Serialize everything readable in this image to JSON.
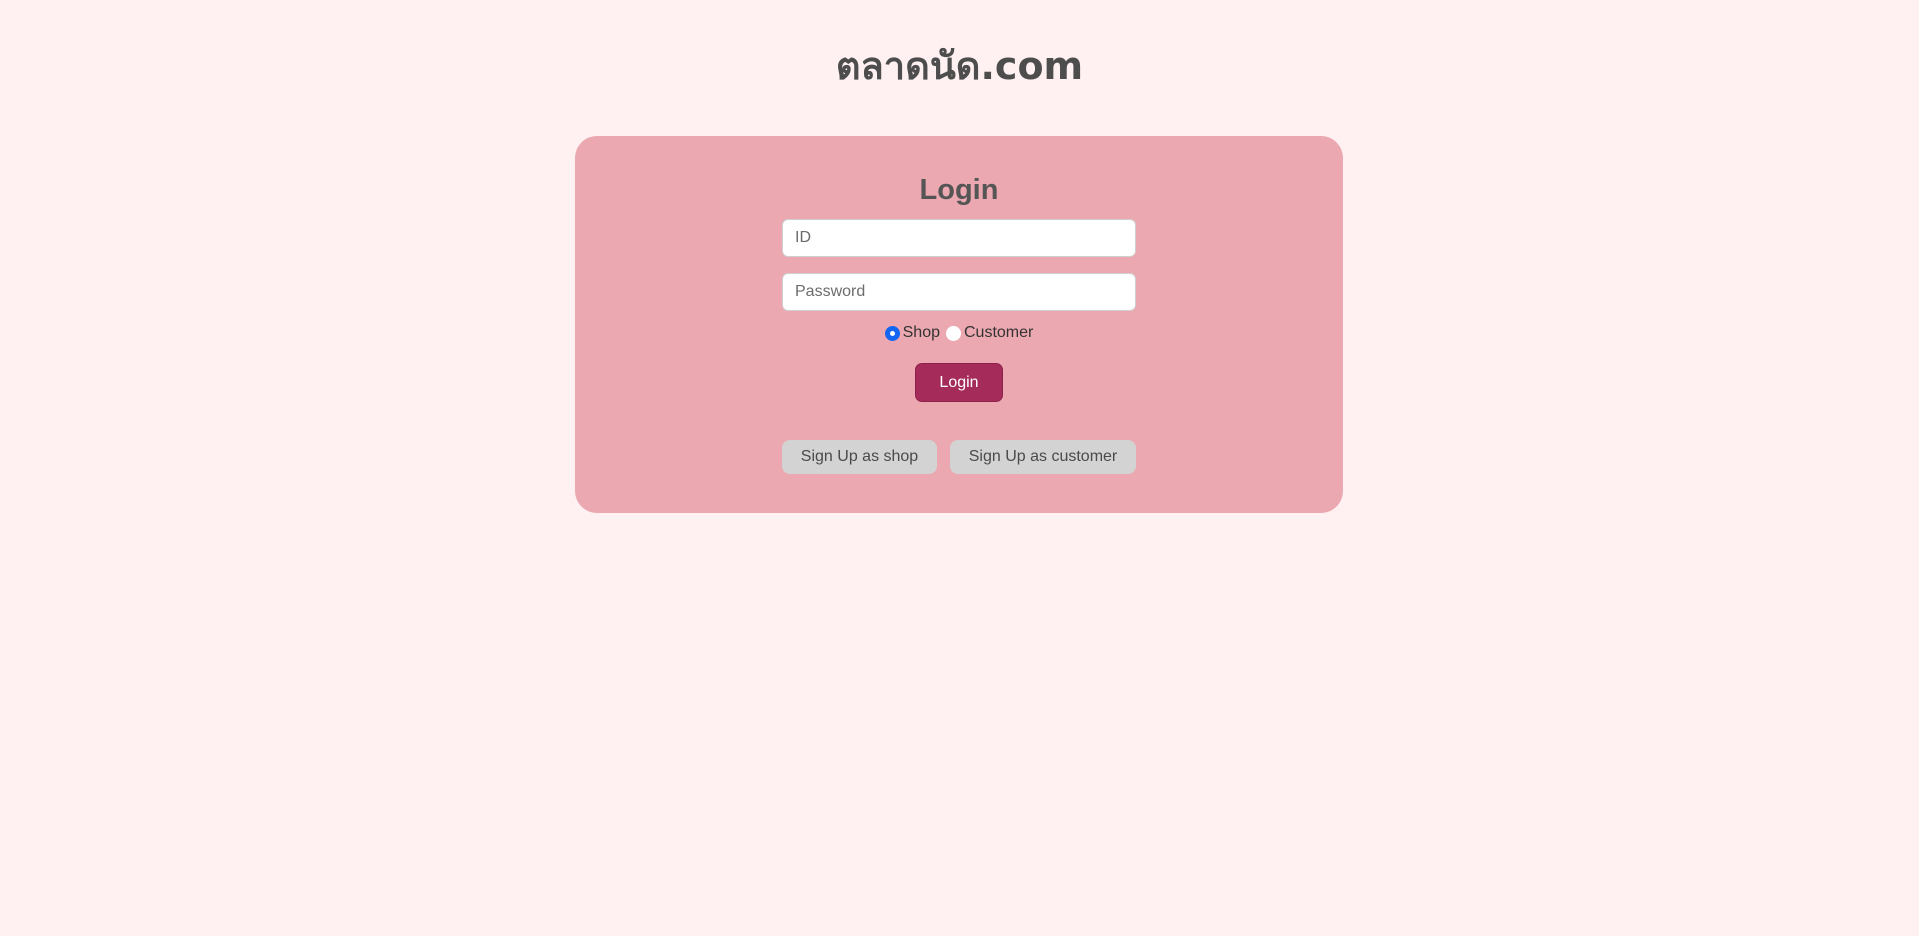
{
  "site": {
    "title": "ตลาดนัด.com"
  },
  "login_form": {
    "heading": "Login",
    "id_placeholder": "ID",
    "password_placeholder": "Password",
    "roles": [
      {
        "label": "Shop",
        "selected": true
      },
      {
        "label": "Customer",
        "selected": false
      }
    ],
    "submit_label": "Login",
    "signup_shop_label": "Sign Up as shop",
    "signup_customer_label": "Sign Up as customer"
  },
  "colors": {
    "page_background": "#fff0f2",
    "card_background": "#eca8b0",
    "primary_button": "#a52b5a",
    "secondary_button": "#d3d3d3",
    "radio_selected": "#1266f1"
  }
}
